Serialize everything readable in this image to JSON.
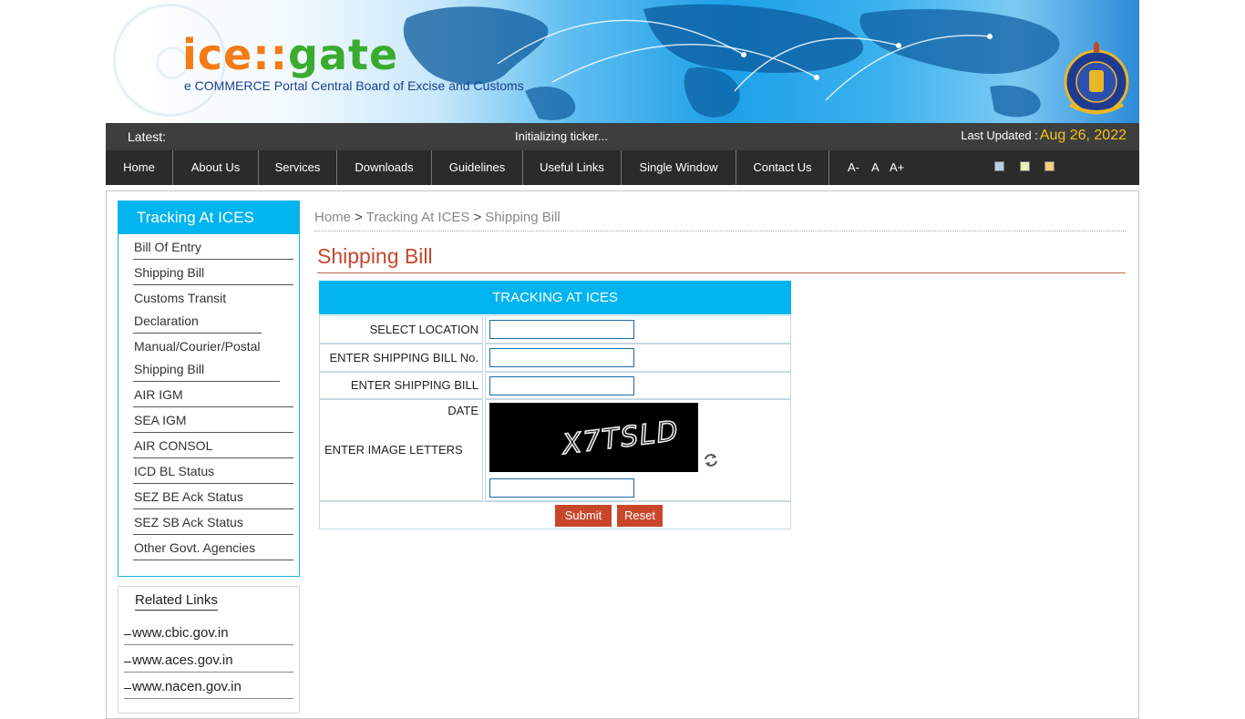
{
  "header": {
    "logo_part1": "ice",
    "logo_part2": "::",
    "logo_part3": "gate",
    "tagline": "e COMMERCE Portal Central Board of Excise and Customs"
  },
  "ticker": {
    "latest_label": "Latest:",
    "message": "Initializing ticker...",
    "updated_label": "Last Updated :",
    "updated_date": "Aug 26, 2022"
  },
  "nav": {
    "items": [
      "Home",
      "About Us",
      "Services",
      "Downloads",
      "Guidelines",
      "Useful Links",
      "Single Window",
      "Contact Us"
    ],
    "font_small": "A-",
    "font_normal": "A",
    "font_large": "A+",
    "theme_colors": [
      "#b9cde8",
      "#e4f0b8",
      "#f5cf7d"
    ]
  },
  "sidebar": {
    "title": "Tracking At ICES",
    "items": [
      "Bill Of Entry",
      "Shipping Bill",
      "Customs Transit Declaration",
      "Manual/Courier/Postal Shipping Bill",
      "AIR IGM",
      "SEA IGM",
      "AIR CONSOL",
      "ICD BL Status",
      "SEZ BE Ack Status",
      "SEZ SB Ack Status",
      "Other Govt. Agencies"
    ]
  },
  "related": {
    "title": "Related Links",
    "links": [
      "www.cbic.gov.in",
      "www.aces.gov.in",
      "www.nacen.gov.in"
    ]
  },
  "breadcrumb": {
    "home": "Home",
    "sep": ">",
    "level1": "Tracking At ICES",
    "current": "Shipping Bill"
  },
  "page": {
    "title": "Shipping Bill"
  },
  "form": {
    "header": "TRACKING AT ICES",
    "location_label": "SELECT LOCATION",
    "location_value": "",
    "sbno_label": "ENTER SHIPPING BILL No.",
    "sbno_value": "",
    "sbdate_label": "ENTER SHIPPING BILL DATE",
    "sbdate_value": "",
    "captcha_label": "ENTER IMAGE LETTERS",
    "captcha_text": "X7TSLD",
    "captcha_value": "",
    "submit_label": "Submit",
    "reset_label": "Reset"
  }
}
